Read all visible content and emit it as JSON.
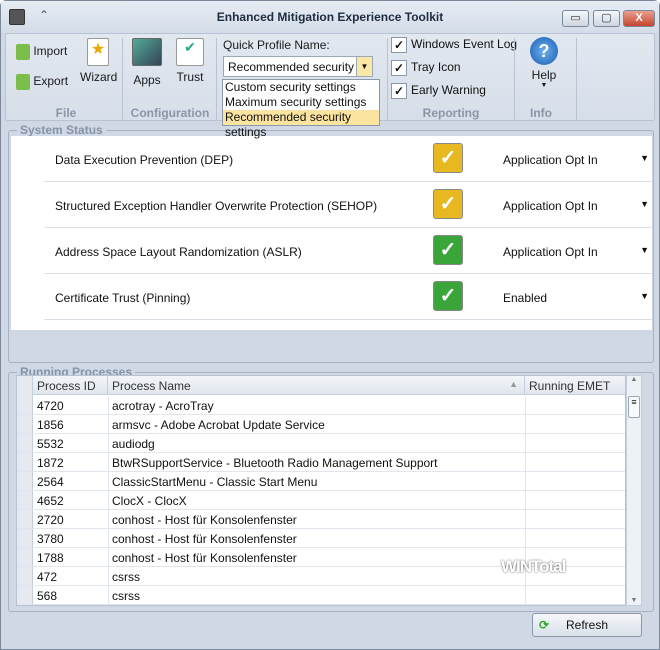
{
  "window": {
    "title": "Enhanced Mitigation Experience Toolkit",
    "minimize": "▭",
    "maximize": "▢",
    "close": "X",
    "qat": "⌃"
  },
  "ribbon": {
    "file": {
      "label": "File",
      "import": "Import",
      "export": "Export",
      "wizard": "Wizard"
    },
    "configuration": {
      "label": "Configuration",
      "apps": "Apps",
      "trust": "Trust"
    },
    "profile": {
      "label": "Quick Profile Name:",
      "value": "Recommended security ...",
      "options": [
        "Custom security settings",
        "Maximum security settings",
        "Recommended security settings"
      ]
    },
    "reporting": {
      "label": "Reporting",
      "items": [
        {
          "label": "Windows Event Log",
          "checked": true
        },
        {
          "label": "Tray Icon",
          "checked": true
        },
        {
          "label": "Early Warning",
          "checked": true
        }
      ]
    },
    "info": {
      "label": "Info",
      "help": "Help"
    }
  },
  "system_status": {
    "title": "System Status",
    "rows": [
      {
        "name": "Data Execution Prevention (DEP)",
        "value": "Application Opt In",
        "status": "warning",
        "color": "#e8b820"
      },
      {
        "name": "Structured Exception Handler Overwrite Protection (SEHOP)",
        "value": "Application Opt In",
        "status": "warning",
        "color": "#e8b820"
      },
      {
        "name": "Address Space Layout Randomization (ASLR)",
        "value": "Application Opt In",
        "status": "ok",
        "color": "#3aa63a"
      },
      {
        "name": "Certificate Trust (Pinning)",
        "value": "Enabled",
        "status": "ok",
        "color": "#3aa63a"
      }
    ]
  },
  "processes": {
    "title": "Running Processes",
    "columns": [
      "Process ID",
      "Process Name",
      "Running EMET"
    ],
    "rows": [
      [
        "4720",
        "acrotray - AcroTray",
        ""
      ],
      [
        "1856",
        "armsvc - Adobe Acrobat Update Service",
        ""
      ],
      [
        "5532",
        "audiodg",
        ""
      ],
      [
        "1872",
        "BtwRSupportService - Bluetooth Radio Management Support",
        ""
      ],
      [
        "2564",
        "ClassicStartMenu - Classic Start Menu",
        ""
      ],
      [
        "4652",
        "ClocX - ClocX",
        ""
      ],
      [
        "2720",
        "conhost - Host für Konsolenfenster",
        ""
      ],
      [
        "3780",
        "conhost - Host für Konsolenfenster",
        ""
      ],
      [
        "1788",
        "conhost - Host für Konsolenfenster",
        ""
      ],
      [
        "472",
        "csrss",
        ""
      ],
      [
        "568",
        "csrss",
        ""
      ]
    ]
  },
  "refresh": "Refresh",
  "watermark": "WINTotal"
}
